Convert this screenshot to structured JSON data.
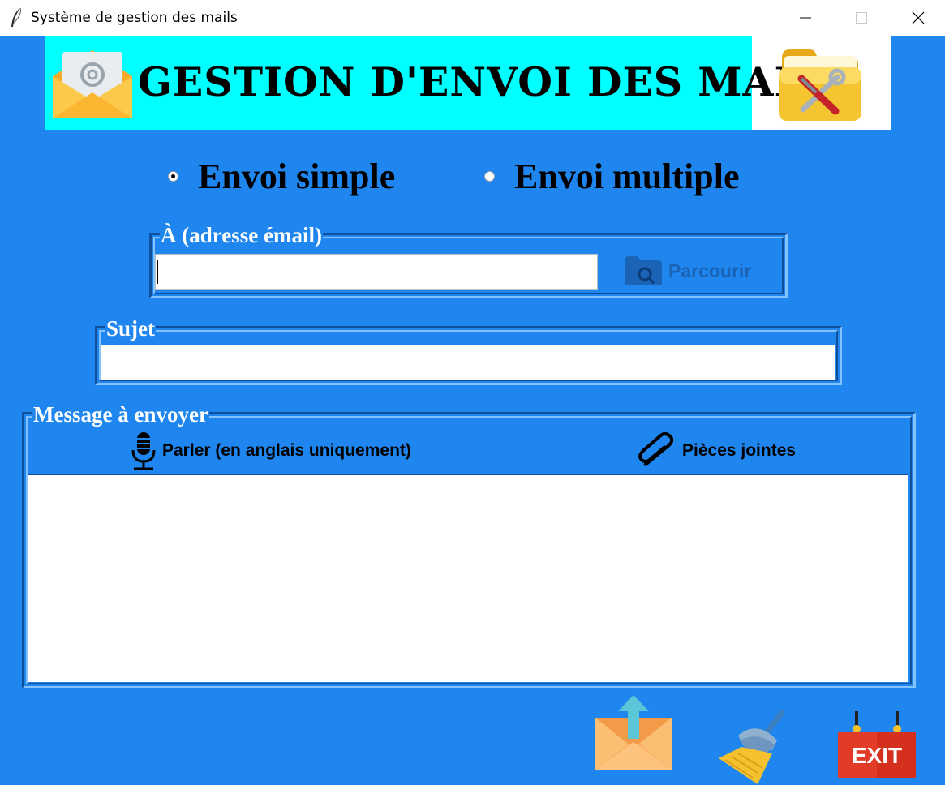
{
  "window": {
    "title": "Système de gestion des mails",
    "icon": "feather-icon"
  },
  "banner": {
    "title": "GESTION D'ENVOI DES MAILS",
    "left_icon": "email-envelope-icon",
    "right_icon": "folder-tools-icon"
  },
  "mode": {
    "options": [
      {
        "label": "Envoi simple",
        "selected": true
      },
      {
        "label": "Envoi multiple",
        "selected": false
      }
    ]
  },
  "to_field": {
    "legend": "À (adresse émail)",
    "value": "",
    "browse_label": "Parcourir",
    "browse_icon": "folder-search-icon"
  },
  "subject_field": {
    "legend": "Sujet",
    "value": ""
  },
  "message": {
    "legend": "Message à envoyer",
    "speak_label": "Parler (en anglais uniquement)",
    "speak_icon": "microphone-icon",
    "attach_label": "Pièces jointes",
    "attach_icon": "paperclip-icon",
    "body": ""
  },
  "actions": [
    {
      "name": "send",
      "icon": "send-envelope-icon"
    },
    {
      "name": "clear",
      "icon": "broom-icon"
    },
    {
      "name": "exit",
      "icon": "exit-sign-icon",
      "text": "EXIT"
    }
  ],
  "colors": {
    "background": "#1e86ee",
    "banner": "#00ffff",
    "legend_text": "#ffffff"
  }
}
